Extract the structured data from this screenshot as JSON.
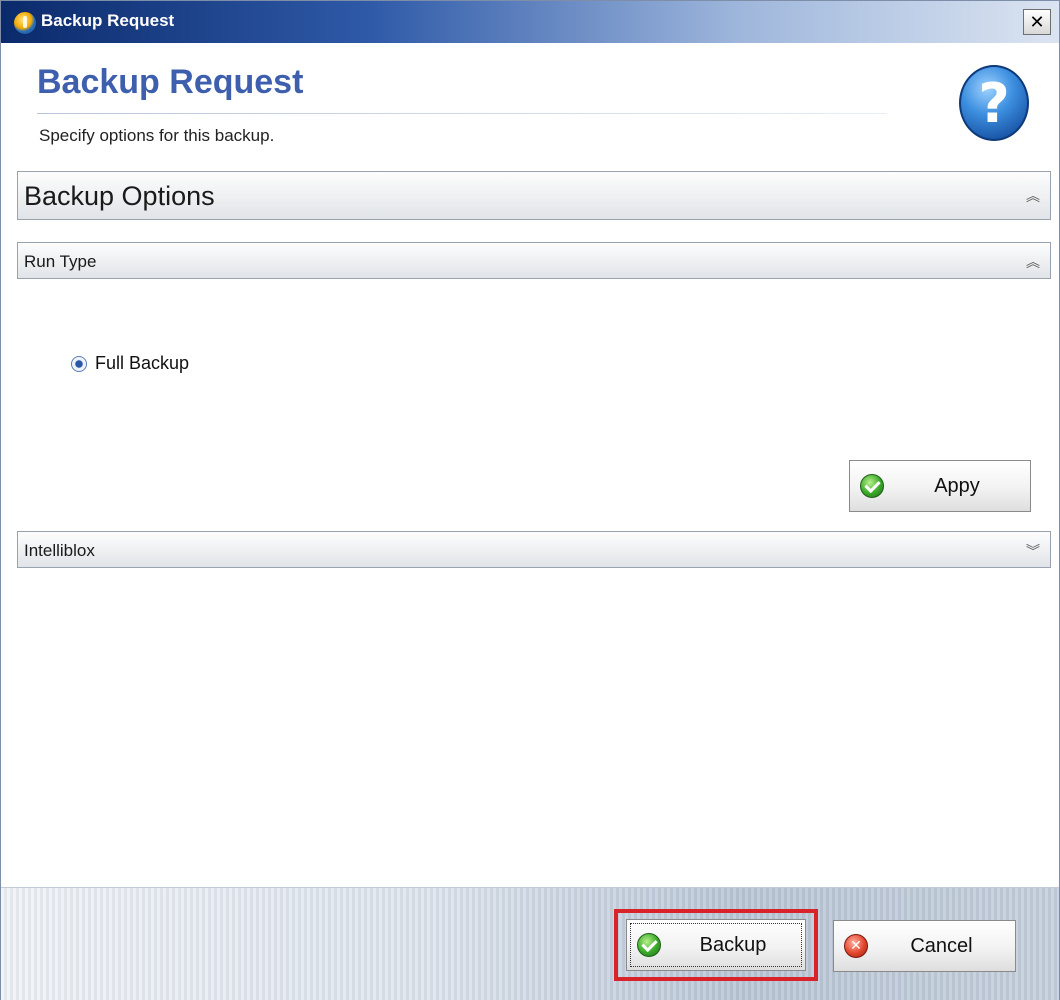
{
  "window": {
    "title": "Backup Request",
    "close_symbol": "✕"
  },
  "header": {
    "title": "Backup Request",
    "subtitle": "Specify options for this backup.",
    "help_icon": "help-icon",
    "help_symbol": "?"
  },
  "sections": {
    "backup_options": {
      "label": "Backup Options",
      "state": "expanded",
      "toggle_symbol": "︽"
    },
    "run_type": {
      "label": "Run Type",
      "state": "expanded",
      "toggle_symbol": "︽"
    },
    "intelliblox": {
      "label": "Intelliblox",
      "state": "collapsed",
      "toggle_symbol": "︾"
    }
  },
  "run_type": {
    "option_label": "Full Backup",
    "selected": true
  },
  "buttons": {
    "apply": {
      "label": "Appy",
      "icon": "ok-check-icon"
    },
    "backup": {
      "label": "Backup",
      "icon": "ok-check-icon"
    },
    "cancel": {
      "label": "Cancel",
      "icon": "cancel-x-icon",
      "symbol": "✕"
    }
  },
  "colors": {
    "title_accent": "#3e5fae",
    "highlight": "#d8232a",
    "titlebar_start": "#0b2a6b"
  }
}
